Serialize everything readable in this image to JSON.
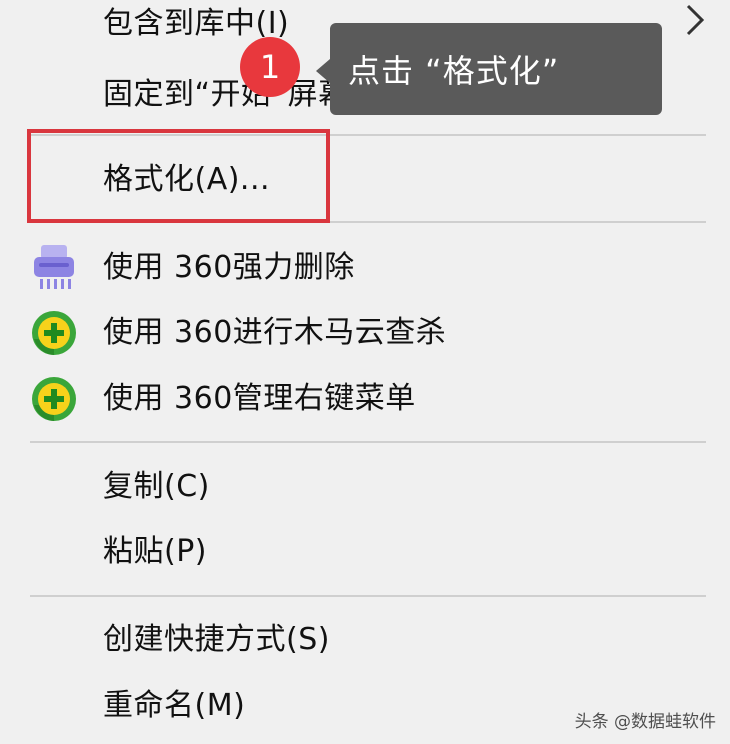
{
  "menu": {
    "items": [
      {
        "label": "包含到库中(I)"
      },
      {
        "label": "固定到“开始”屏幕(P)"
      },
      {
        "label": "格式化(A)..."
      },
      {
        "label": "使用 360强力删除"
      },
      {
        "label": "使用 360进行木马云查杀"
      },
      {
        "label": "使用 360管理右键菜单"
      },
      {
        "label": "复制(C)"
      },
      {
        "label": "粘贴(P)"
      },
      {
        "label": "创建快捷方式(S)"
      },
      {
        "label": "重命名(M)"
      }
    ]
  },
  "tooltip": {
    "text": "点击 “格式化”",
    "step_number": "1"
  },
  "icons": {
    "submenu": "chevron-right-icon",
    "shredder": "shredder-icon",
    "trojan_scan": "360-icon",
    "manage_menu": "360-icon"
  },
  "colors": {
    "highlight_border": "#d9363e",
    "badge": "#e8383d",
    "tooltip_bg": "#5a5a5a",
    "menu_bg": "#f0f0f0"
  },
  "watermark": "头条 @数据蛙软件"
}
